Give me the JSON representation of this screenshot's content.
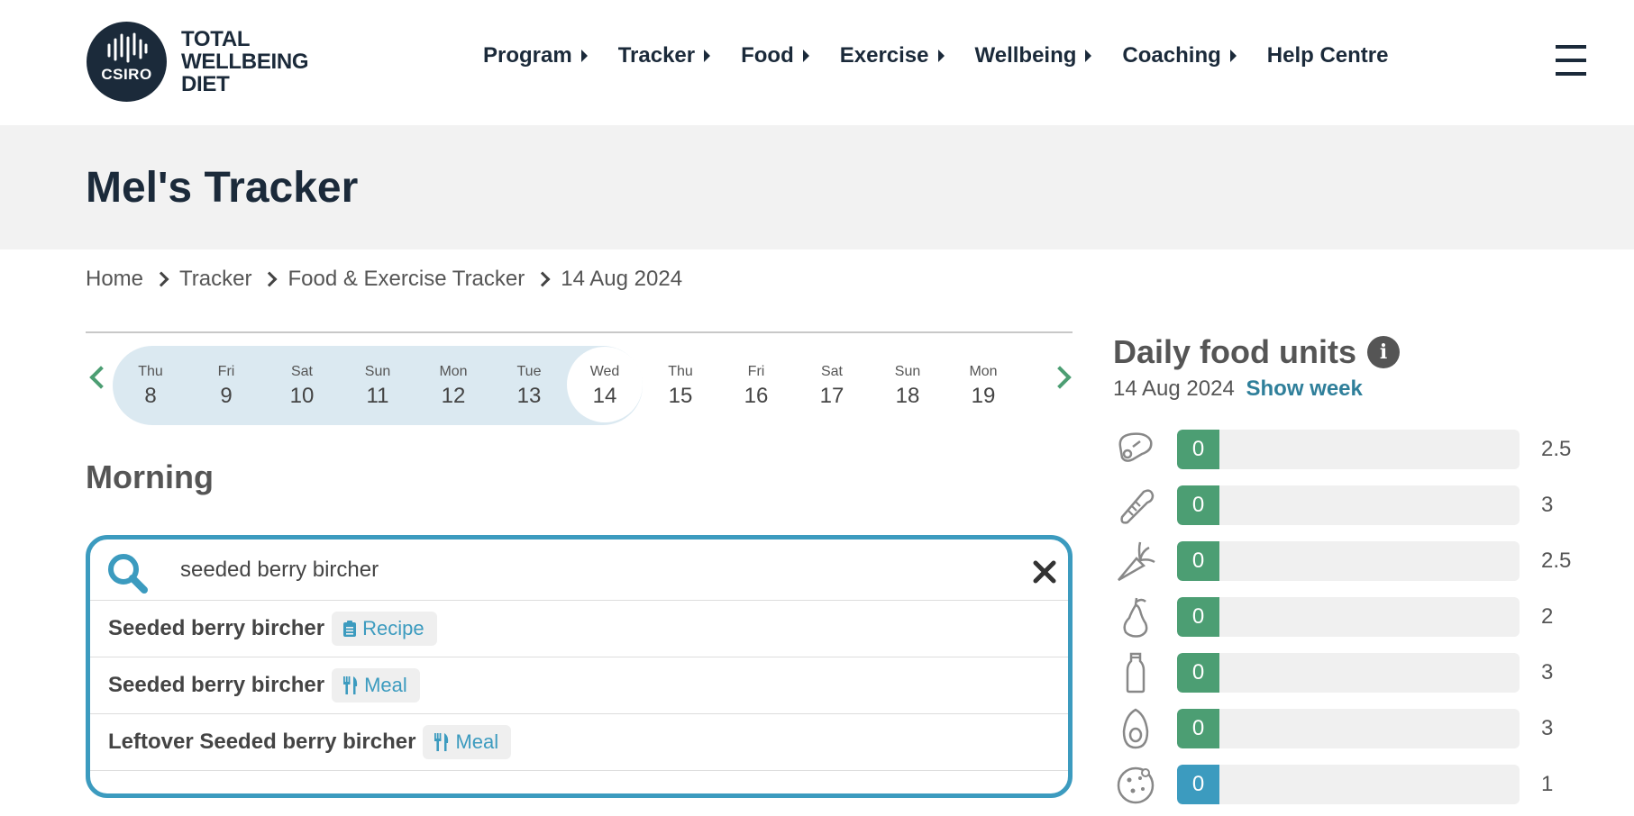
{
  "brand": {
    "logo_badge": "CSIRO",
    "logo_line1": "TOTAL",
    "logo_line2": "WELLBEING",
    "logo_line3": "DIET"
  },
  "nav": {
    "items": [
      {
        "label": "Program",
        "has_menu": true
      },
      {
        "label": "Tracker",
        "has_menu": true
      },
      {
        "label": "Food",
        "has_menu": true
      },
      {
        "label": "Exercise",
        "has_menu": true
      },
      {
        "label": "Wellbeing",
        "has_menu": true
      },
      {
        "label": "Coaching",
        "has_menu": true
      },
      {
        "label": "Help Centre",
        "has_menu": false
      }
    ],
    "menu_icon": "hamburger-icon"
  },
  "page": {
    "title": "Mel's Tracker"
  },
  "breadcrumb": [
    "Home",
    "Tracker",
    "Food & Exercise Tracker",
    "14 Aug 2024"
  ],
  "date_strip": {
    "days": [
      {
        "name": "Thu",
        "num": "8"
      },
      {
        "name": "Fri",
        "num": "9"
      },
      {
        "name": "Sat",
        "num": "10"
      },
      {
        "name": "Sun",
        "num": "11"
      },
      {
        "name": "Mon",
        "num": "12"
      },
      {
        "name": "Tue",
        "num": "13"
      },
      {
        "name": "Wed",
        "num": "14"
      },
      {
        "name": "Thu",
        "num": "15"
      },
      {
        "name": "Fri",
        "num": "16"
      },
      {
        "name": "Sat",
        "num": "17"
      },
      {
        "name": "Sun",
        "num": "18"
      },
      {
        "name": "Mon",
        "num": "19"
      }
    ],
    "selected_day": "14",
    "accent_color": "#4c9e73",
    "week_highlight_color": "#dbe9f1"
  },
  "section": {
    "heading": "Morning"
  },
  "search": {
    "value": "seeded berry bircher",
    "placeholder": "",
    "accent_color": "#3c9bbf",
    "results": [
      {
        "name": "Seeded berry bircher",
        "tag": "Recipe",
        "tag_icon": "clipboard-icon"
      },
      {
        "name": "Seeded berry bircher",
        "tag": "Meal",
        "tag_icon": "cutlery-icon"
      },
      {
        "name": "Leftover Seeded berry bircher",
        "tag": "Meal",
        "tag_icon": "cutlery-icon"
      }
    ]
  },
  "daily_food_units": {
    "title": "Daily food units",
    "date": "14 Aug 2024",
    "show_week_label": "Show week",
    "rows": [
      {
        "icon": "meat-icon",
        "value": "0",
        "target": "2.5",
        "color": "#4c9e73"
      },
      {
        "icon": "bread-icon",
        "value": "0",
        "target": "3",
        "color": "#4c9e73"
      },
      {
        "icon": "carrot-icon",
        "value": "0",
        "target": "2.5",
        "color": "#4c9e73"
      },
      {
        "icon": "pear-icon",
        "value": "0",
        "target": "2",
        "color": "#4c9e73"
      },
      {
        "icon": "milk-bottle-icon",
        "value": "0",
        "target": "3",
        "color": "#4c9e73"
      },
      {
        "icon": "avocado-icon",
        "value": "0",
        "target": "3",
        "color": "#4c9e73"
      },
      {
        "icon": "cookie-icon",
        "value": "0",
        "target": "1",
        "color": "#3c9bbf"
      }
    ]
  }
}
